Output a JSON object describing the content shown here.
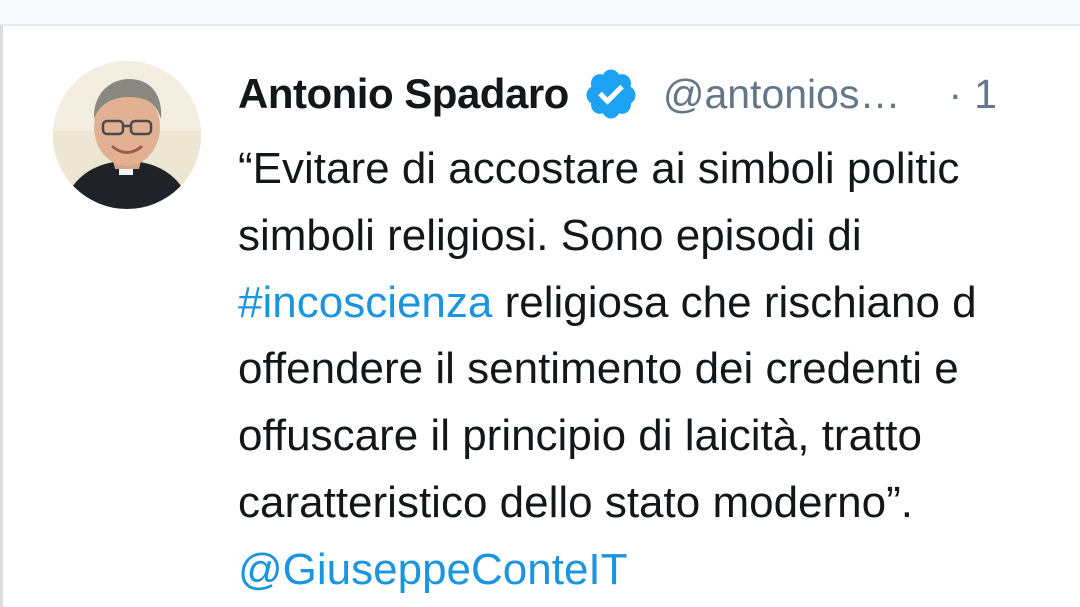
{
  "tweet": {
    "author": {
      "name": "Antonio Spadaro",
      "handle": "@antonios…",
      "verified": true
    },
    "separator": "·",
    "time_fragment": "1",
    "text_lines": [
      {
        "segments": [
          {
            "type": "text",
            "value": "“Evitare di accostare ai simboli politic"
          }
        ]
      },
      {
        "segments": [
          {
            "type": "text",
            "value": "simboli religiosi. Sono episodi di"
          }
        ]
      },
      {
        "segments": [
          {
            "type": "hashtag",
            "value": "#incoscienza"
          },
          {
            "type": "text",
            "value": " religiosa che rischiano d"
          }
        ]
      },
      {
        "segments": [
          {
            "type": "text",
            "value": "offendere il sentimento dei credenti e"
          }
        ]
      },
      {
        "segments": [
          {
            "type": "text",
            "value": "offuscare il principio di laicità, tratto"
          }
        ]
      },
      {
        "segments": [
          {
            "type": "text",
            "value": "caratteristico dello stato moderno”."
          }
        ]
      },
      {
        "segments": [
          {
            "type": "mention",
            "value": "@GiuseppeConteIT"
          }
        ]
      }
    ]
  },
  "icons": {
    "verified_badge": "verified-badge-icon",
    "avatar": "profile-photo"
  },
  "colors": {
    "link": "#1b95e0",
    "verified": "#1da1f2",
    "text": "#14171a",
    "secondary": "#657786"
  }
}
